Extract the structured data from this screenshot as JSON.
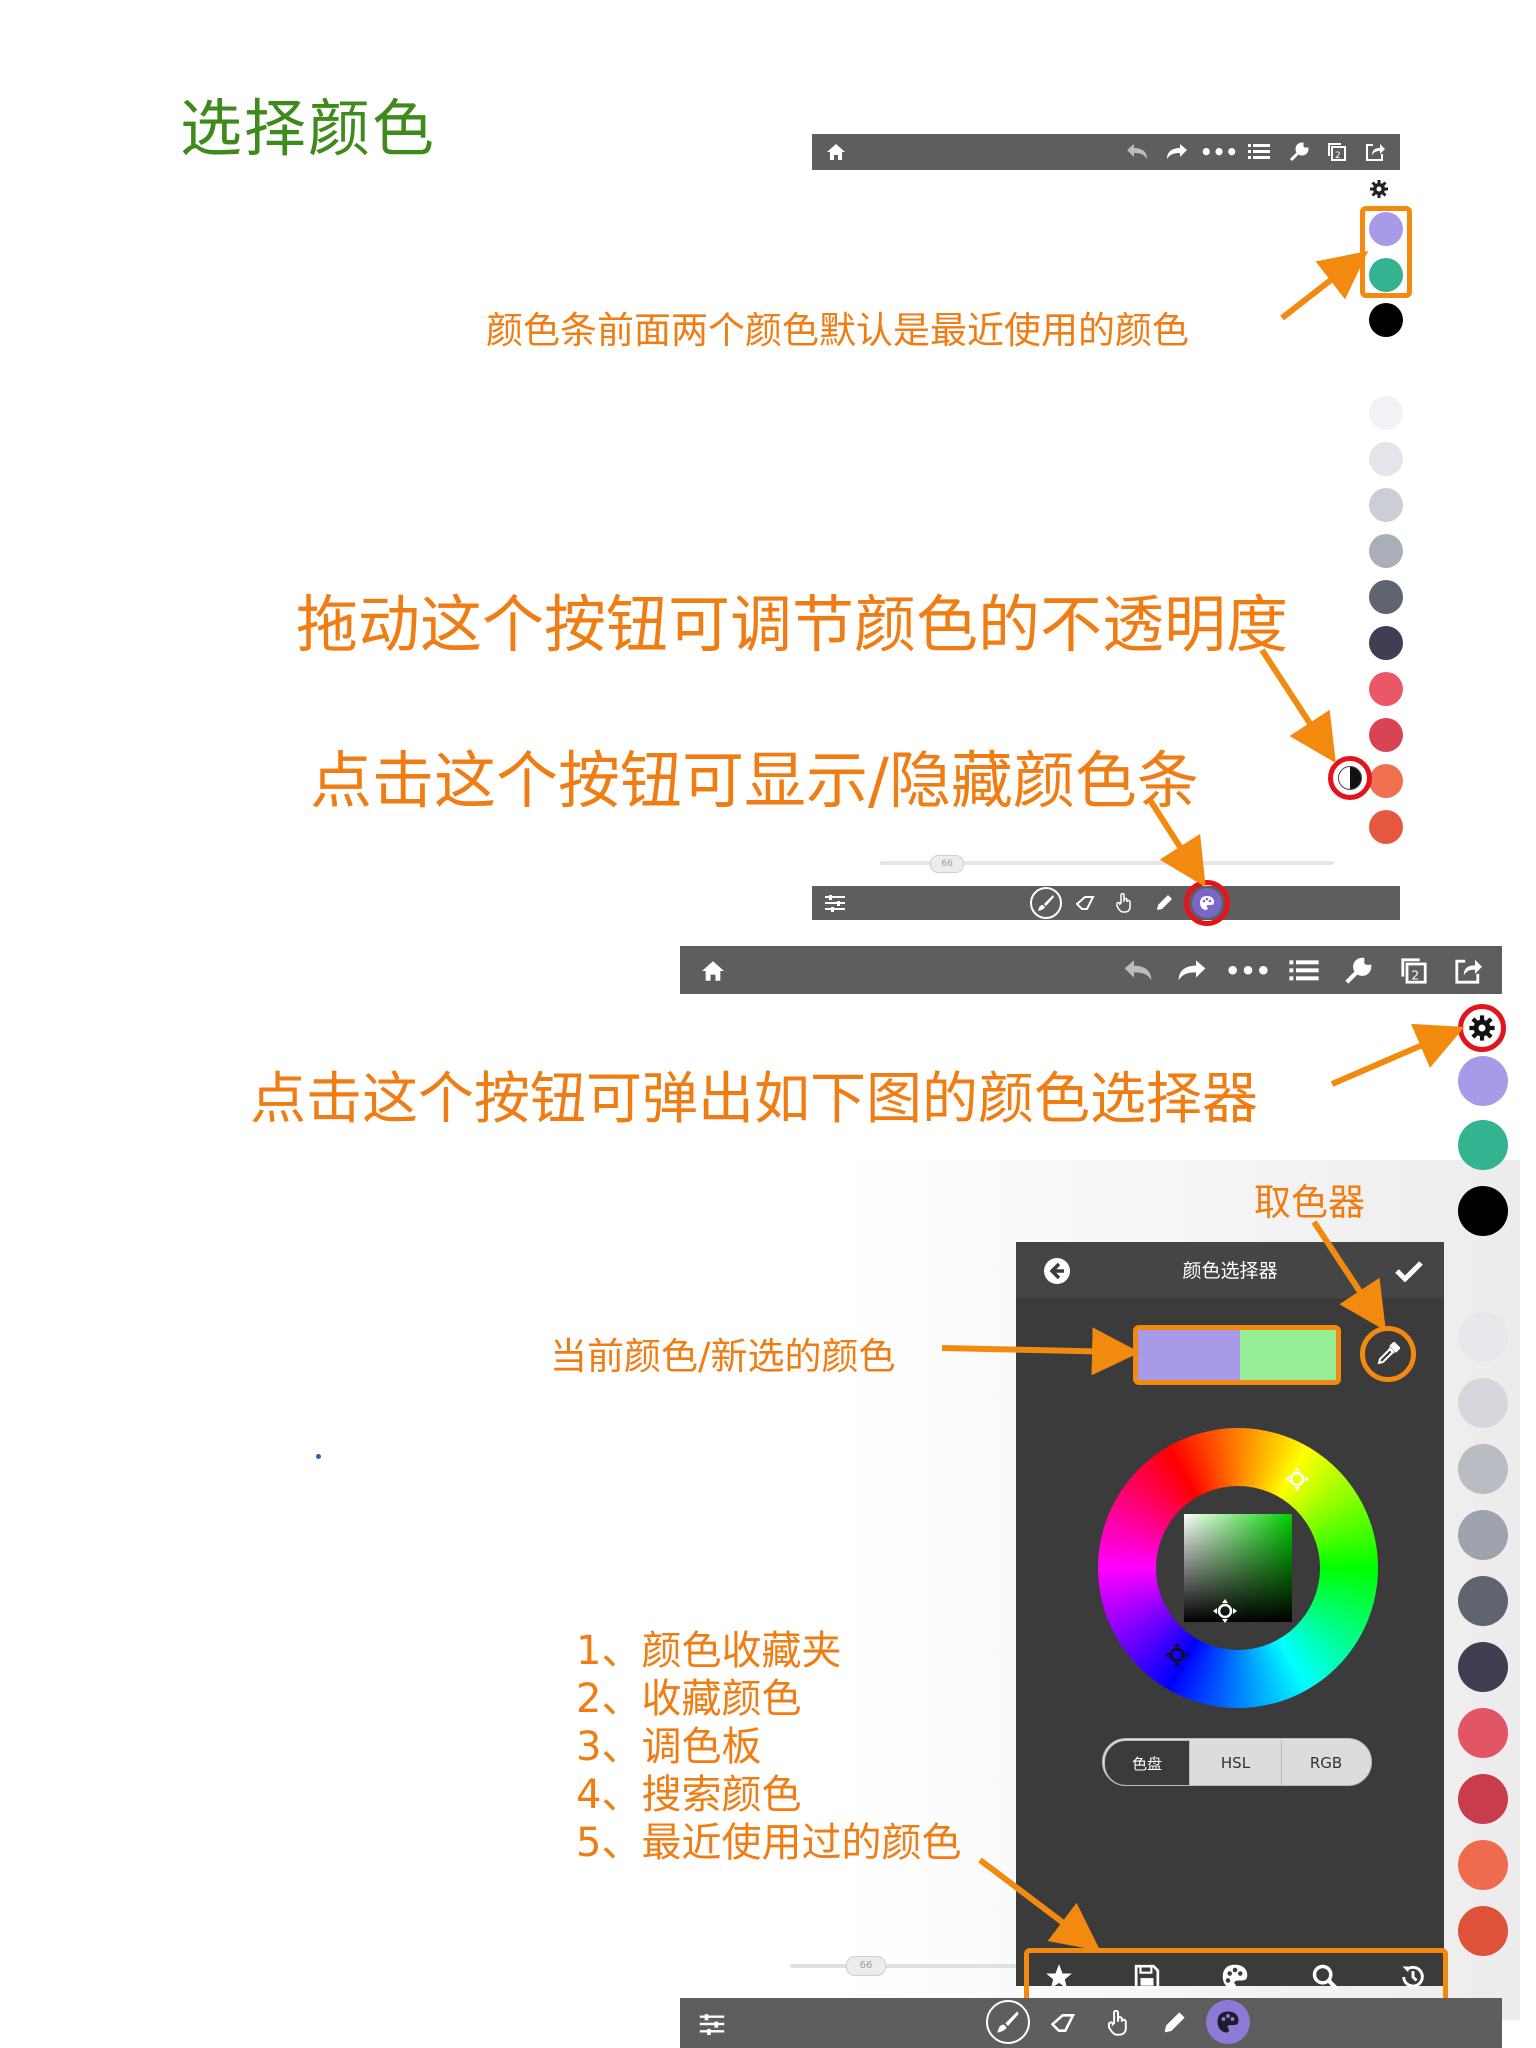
{
  "page_title": "选择颜色",
  "annotations": {
    "recent_colors": "颜色条前面两个颜色默认是最近使用的颜色",
    "opacity": "拖动这个按钮可调节颜色的不透明度",
    "toggle_bar": "点击这个按钮可显示/隐藏颜色条",
    "open_picker": "点击这个按钮可弹出如下图的颜色选择器",
    "eyedropper": "取色器",
    "current_new": "当前颜色/新选的颜色",
    "list": [
      "1、颜色收藏夹",
      "2、收藏颜色",
      "3、调色板",
      "4、搜索颜色",
      "5、最近使用过的颜色"
    ]
  },
  "top_screenshot": {
    "brush_size": "66",
    "colors": {
      "recent_1": "#a99ae8",
      "recent_2": "#33b38f",
      "black": "#000000",
      "palette": [
        "#f1f2f5",
        "#e3e5ea",
        "#cbced6",
        "#a9aeb8",
        "#5f6470",
        "#3f3e52",
        "#ea5867",
        "#d84454",
        "#f0704f",
        "#e5583f"
      ]
    }
  },
  "picker": {
    "title": "颜色选择器",
    "tabs": [
      "色盘",
      "HSL",
      "RGB"
    ],
    "current_color": "#a99ae8",
    "new_color": "#96ee96",
    "brush_size": "66",
    "side_palette": [
      "#e7e8ec",
      "#d5d7dc",
      "#b9bcc3",
      "#9ea3ad",
      "#5f6470",
      "#3f3e52",
      "#e25564",
      "#c93c4c",
      "#ee6b4e",
      "#dd5238"
    ]
  },
  "icons": {
    "home": "home-icon",
    "undo": "undo-icon",
    "redo": "redo-icon",
    "more": "more-icon",
    "layers": "list-icon",
    "wrench": "wrench-icon",
    "pages": "pages-icon",
    "share": "share-icon",
    "settings": "gear-icon",
    "back": "back-arrow-icon",
    "confirm": "checkmark-icon",
    "eyedropper": "eyedropper-icon",
    "star": "star-icon",
    "save": "floppy-icon",
    "palette": "palette-icon",
    "search": "search-icon",
    "history": "history-icon"
  }
}
